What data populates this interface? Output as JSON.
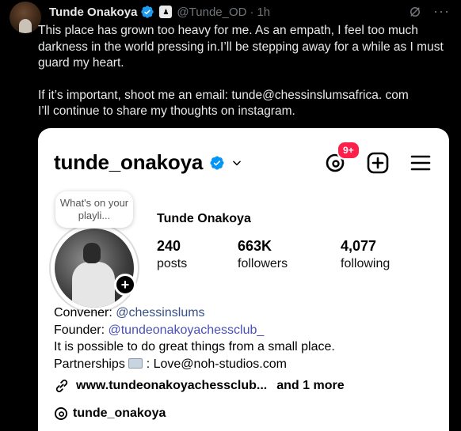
{
  "tweet": {
    "author_name": "Tunde Onakoya",
    "handle": "@Tunde_OD",
    "separator": "·",
    "time": "1h",
    "icons": [
      "verified-badge-icon",
      "affiliate-badge-icon",
      "grok-icon",
      "more-icon"
    ],
    "paragraph1": "This place has grown too heavy for me. As an empath, I feel too much darkness in the world pressing in.I’ll be stepping away for a while as I must guard my heart.",
    "paragraph2_line1": "If it’s important, shoot me an email: tunde@chessinslumsafrica. com",
    "paragraph2_line2": "I’ll continue to share my thoughts on instagram."
  },
  "instagram": {
    "username": "tunde_onakoya",
    "notification_badge": "9+",
    "note_text": "What's on your playli...",
    "profile_name": "Tunde Onakoya",
    "stats": [
      {
        "value": "240",
        "label": "posts"
      },
      {
        "value": "663K",
        "label": "followers"
      },
      {
        "value": "4,077",
        "label": "following"
      }
    ],
    "bio": {
      "line1_prefix": "Convener: ",
      "line1_tag": "@chessinslums",
      "line2_prefix": "Founder: ",
      "line2_tag": "@tundeonakoyachessclub_",
      "line3": "It is possible to do great things from a small place.",
      "line4_prefix": "Partnerships ",
      "line4_suffix": " : Love@noh-studios.com"
    },
    "link_text": "www.tundeonakoyachessclub...",
    "link_more": "and 1 more",
    "threads_handle": "tunde_onakoya"
  },
  "colors": {
    "background": "#000000",
    "accent_blue": "#1d9bf0",
    "badge_red": "#ff1f4b",
    "link_blue": "#385185"
  }
}
